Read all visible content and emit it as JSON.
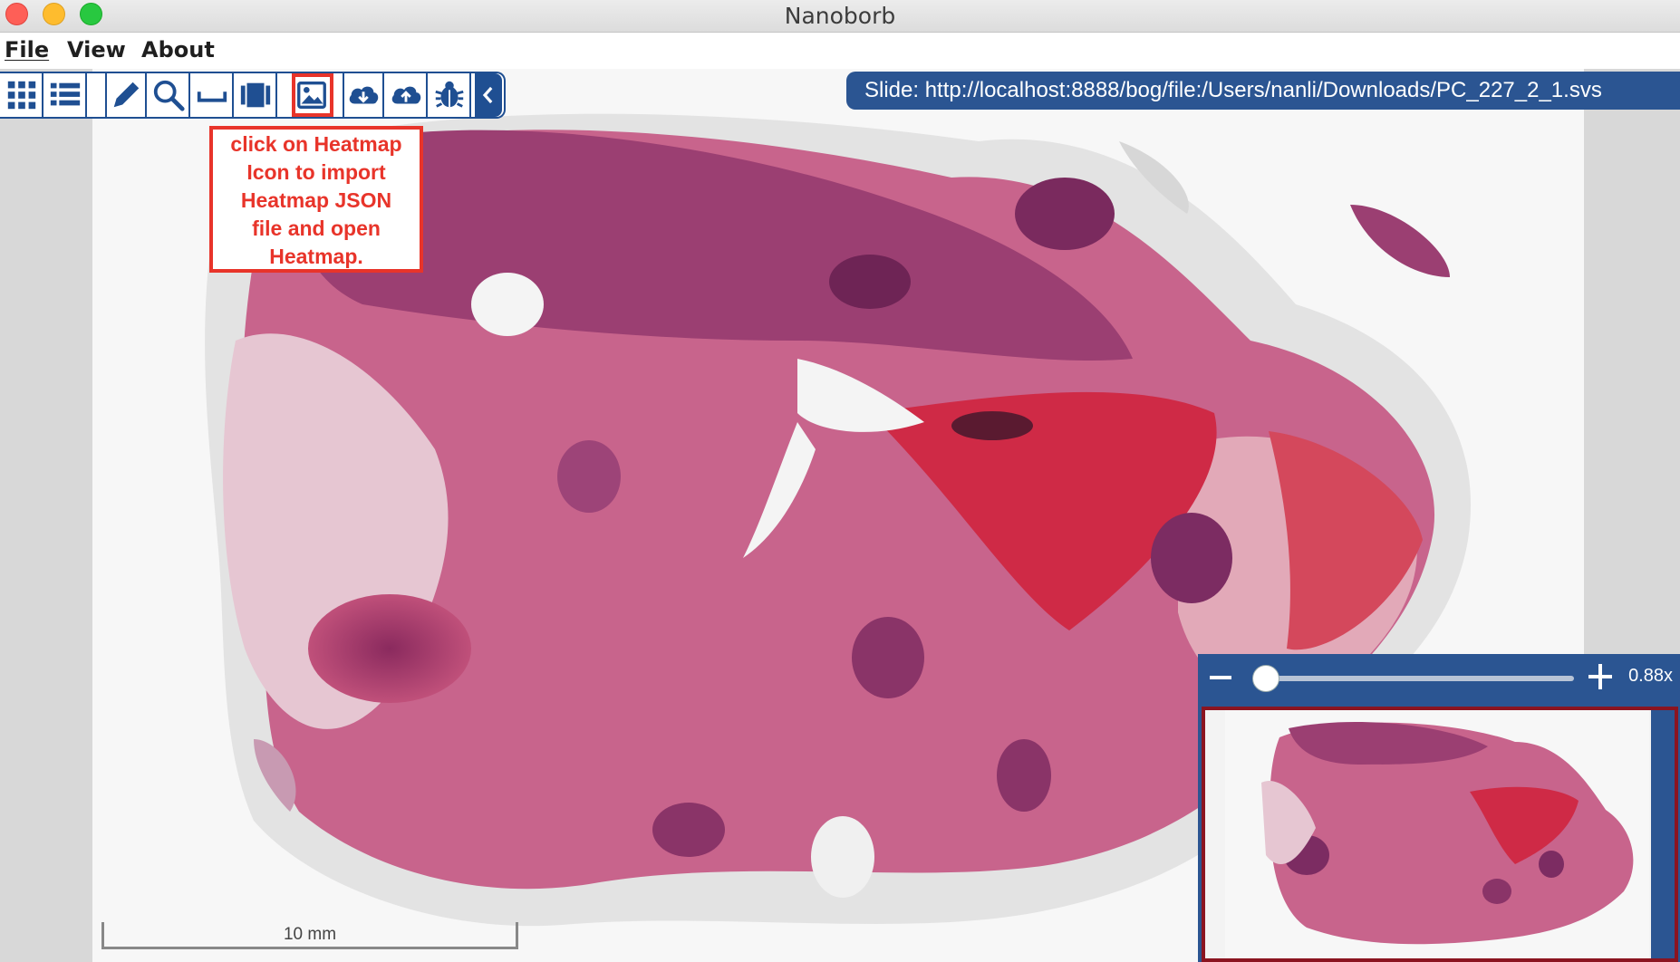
{
  "window": {
    "title": "Nanoborb"
  },
  "menu": {
    "file": "File",
    "view": "View",
    "about": "About"
  },
  "toolbar": {
    "tools": [
      {
        "name": "grid-view-icon"
      },
      {
        "name": "list-view-icon"
      },
      {
        "name": "pencil-icon"
      },
      {
        "name": "magnifier-icon"
      },
      {
        "name": "ruler-icon"
      },
      {
        "name": "film-strip-icon"
      },
      {
        "name": "heatmap-image-icon"
      },
      {
        "name": "download-cloud-icon"
      },
      {
        "name": "upload-cloud-icon"
      },
      {
        "name": "bug-icon"
      },
      {
        "name": "chevron-left-icon"
      }
    ]
  },
  "slide": {
    "path_text": "Slide: http://localhost:8888/bog/file:/Users/nanli/Downloads/PC_227_2_1.svs"
  },
  "callout": {
    "lines": [
      "click on Heatmap",
      "Icon to import",
      "Heatmap JSON",
      "file and open",
      "Heatmap."
    ]
  },
  "zoom": {
    "level_label": "0.88x",
    "slider_fraction": 0.03
  },
  "scale_bar": {
    "label": "10 mm"
  },
  "colors": {
    "accent": "#2b5592",
    "callout": "#e8342a",
    "navigator_frame": "#8b1420"
  }
}
